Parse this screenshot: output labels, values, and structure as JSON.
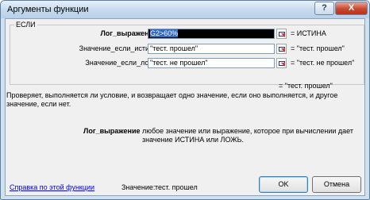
{
  "window": {
    "title": "Аргументы функции",
    "help_button": "?",
    "close_button": "X"
  },
  "function_group": {
    "name": "ЕСЛИ",
    "arguments": [
      {
        "label": "Лог_выражение",
        "value": "G2>60%",
        "result": "= ИСТИНА",
        "bold": true,
        "active": true
      },
      {
        "label": "Значение_если_истина",
        "value": "\"тест. прошел\"",
        "result": "= \"тест. прошел\"",
        "bold": false,
        "active": false
      },
      {
        "label": "Значение_если_ложь",
        "value": "\"тест. не прошел\"",
        "result": "= \"тест. не прошел\"",
        "bold": false,
        "active": false
      }
    ]
  },
  "formula_result": "= \"тест. прошел\"",
  "description": "Проверяет, выполняется ли условие, и возвращает одно значение, если оно выполняется, и другое значение, если нет.",
  "argument_help": {
    "name": "Лог_выражение",
    "text": "любое значение или выражение, которое при вычислении дает значение ИСТИНА или ЛОЖЬ."
  },
  "footer": {
    "help_link": "Справка по этой функции",
    "value_label": "Значение:",
    "value": "тест. прошел",
    "ok_label": "OK",
    "cancel_label": "Отмена"
  }
}
